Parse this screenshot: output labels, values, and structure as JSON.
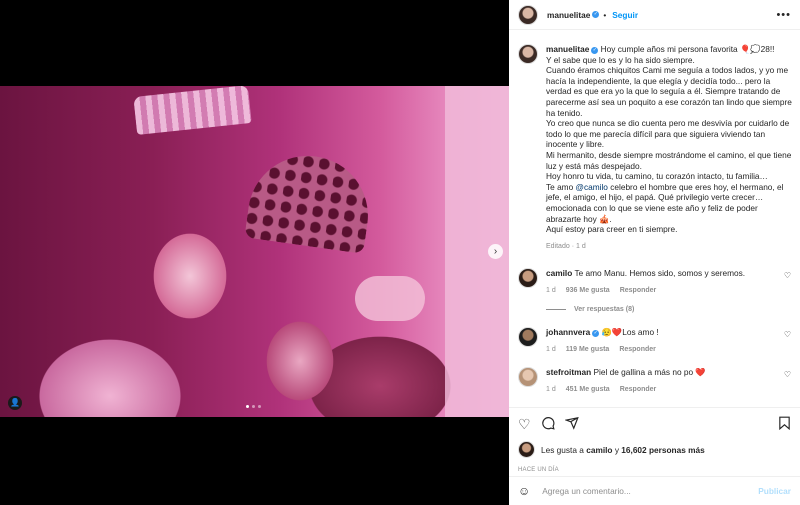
{
  "post": {
    "username": "manuelitae",
    "follow_label": "Seguir",
    "more_label": "•••",
    "carousel_dots": 3,
    "active_dot": 0
  },
  "caption": {
    "lines": [
      "Hoy cumple años mi persona favorita 🎈💭28!!",
      "Y el sabe que lo es y lo ha sido siempre.",
      "Cuando éramos chiquitos Cami me seguía a todos lados, y yo me hacía la independiente, la que elegía y decidía todo... pero la verdad es que era yo la que lo seguía a él. Siempre tratando de parecerme así sea un poquito a ese corazón tan lindo que siempre ha tenido.",
      "Yo creo que nunca se dio cuenta pero me desvivía por cuidarlo de todo lo que me parecía difícil para que siguiera viviendo tan inocente y libre.",
      "Mi hermanito, desde siempre mostrándome el camino, el que tiene luz y está más despejado.",
      "Hoy honro tu vida, tu camino, tu corazón intacto, tu familia…"
    ],
    "mention_prefix": "Te amo ",
    "mention": "@camilo",
    "mention_rest": " celebro el hombre que eres hoy, el hermano, el jefe, el amigo, el hijo, el papá. Qué privilegio verte crecer… emocionada con lo que se viene este año y feliz de poder abrazarte hoy 🎪.",
    "last_line": "Aquí estoy para creer en ti siempre.",
    "edited": "Editado",
    "sep": "·",
    "time": "1 d"
  },
  "comments": [
    {
      "username": "camilo",
      "text": "Te amo Manu. Hemos sido, somos y seremos.",
      "time": "1 d",
      "likes": "936 Me gusta",
      "reply": "Responder",
      "view_replies": "Ver respuestas (8)"
    },
    {
      "username": "johannvera",
      "text": "😥❤️Los amo !",
      "time": "1 d",
      "likes": "119 Me gusta",
      "reply": "Responder"
    },
    {
      "username": "stefroitman",
      "text": "Piel de gallina a más no po ❤️",
      "time": "1 d",
      "likes": "451 Me gusta",
      "reply": "Responder"
    }
  ],
  "likes": {
    "prefix": "Les gusta a ",
    "user": "camilo",
    "middle": " y ",
    "count": "16,602 personas más"
  },
  "ago": "HACE UN DÍA",
  "add_comment": {
    "placeholder": "Agrega un comentario...",
    "post_label": "Publicar"
  }
}
